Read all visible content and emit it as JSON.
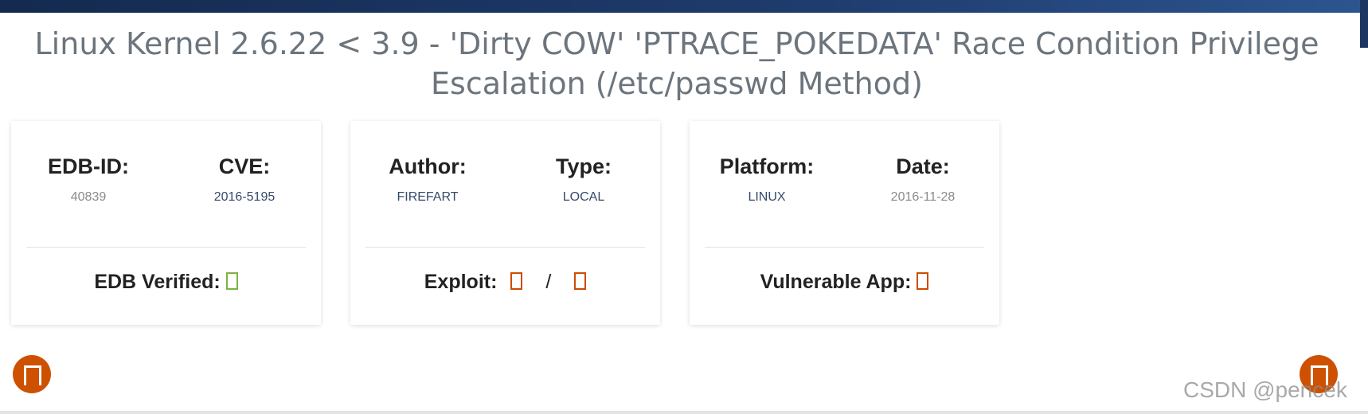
{
  "page": {
    "title": "Linux Kernel 2.6.22 < 3.9 - 'Dirty COW' 'PTRACE_POKEDATA' Race Condition Privilege Escalation (/etc/passwd Method)"
  },
  "cards": [
    {
      "left": {
        "label": "EDB-ID:",
        "value": "40839"
      },
      "right": {
        "label": "CVE:",
        "value": "2016-5195"
      },
      "footer": {
        "label": "EDB Verified:",
        "icons": [
          "verified-icon"
        ]
      }
    },
    {
      "left": {
        "label": "Author:",
        "value": "FIREFART"
      },
      "right": {
        "label": "Type:",
        "value": "LOCAL"
      },
      "footer": {
        "label": "Exploit:",
        "separator": "/",
        "icons": [
          "download-icon",
          "view-icon"
        ]
      }
    },
    {
      "left": {
        "label": "Platform:",
        "value": "LINUX"
      },
      "right": {
        "label": "Date:",
        "value": "2016-11-28"
      },
      "footer": {
        "label": "Vulnerable App:",
        "icons": [
          "app-unavailable-icon"
        ]
      }
    }
  ],
  "fab_buttons": {
    "left_icon": "scroll-button-icon",
    "right_icon": "scroll-button-icon"
  },
  "watermark": "CSDN @pencek",
  "colors": {
    "top_bar": "#1f3c6e",
    "title": "#6c757d",
    "verified_green": "#7cb342",
    "accent_orange": "#cd5100",
    "link_blue": "#36496b"
  }
}
